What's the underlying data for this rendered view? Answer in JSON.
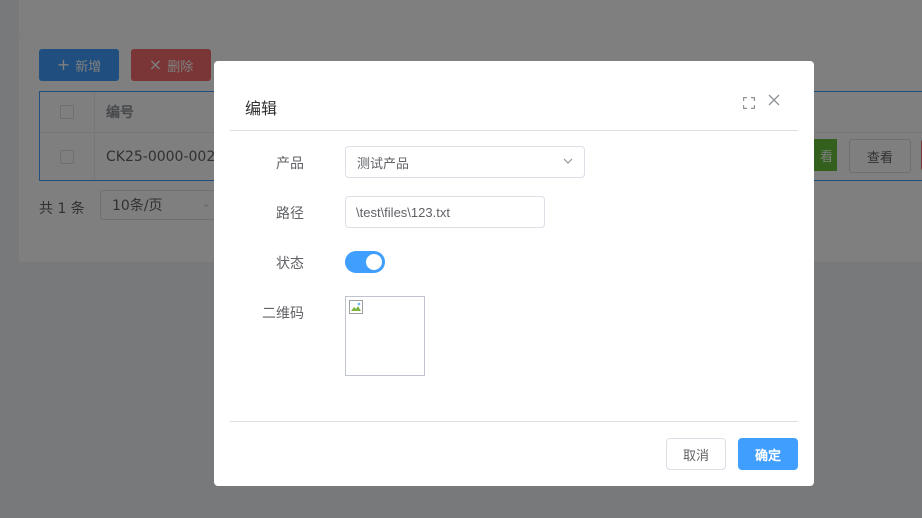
{
  "toolbar": {
    "add_label": "新增",
    "delete_label": "删除"
  },
  "table": {
    "header": {
      "code": "编号"
    },
    "rows": [
      {
        "code": "CK25-0000-002",
        "action_partial": "看",
        "view_label": "查看"
      }
    ]
  },
  "pager": {
    "total_label": "共 1 条",
    "page_size": "10条/页"
  },
  "dialog": {
    "title": "编辑",
    "form": {
      "product_label": "产品",
      "product_value": "测试产品",
      "path_label": "路径",
      "path_value": "\\test\\files\\123.txt",
      "status_label": "状态",
      "status_on": true,
      "qr_label": "二维码"
    },
    "cancel_label": "取消",
    "confirm_label": "确定"
  },
  "colors": {
    "primary": "#409eff",
    "danger": "#f56c6c",
    "success": "#67c23a"
  },
  "icons": {
    "add": "plus-icon",
    "delete": "close-icon",
    "fullscreen": "fullscreen-icon",
    "close": "close-icon",
    "select": "chevron-down-icon"
  }
}
